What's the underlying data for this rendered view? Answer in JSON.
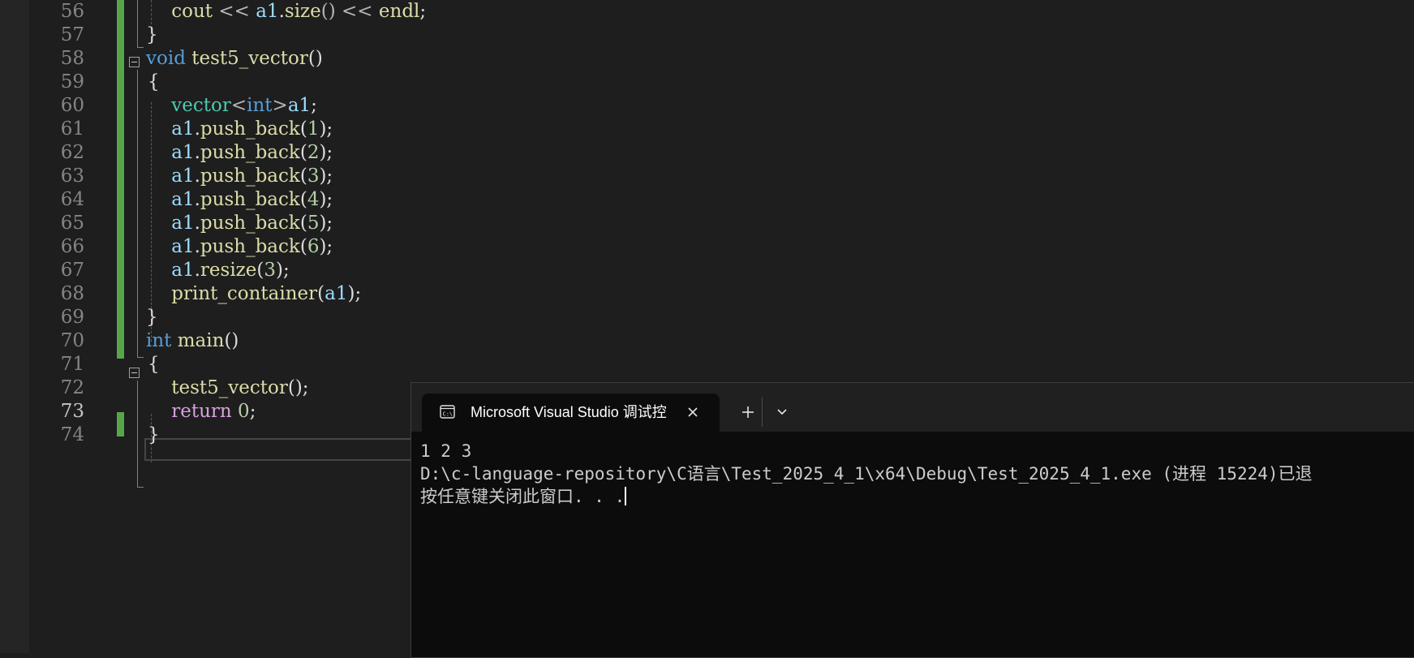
{
  "editor": {
    "line_numbers": [
      "56",
      "57",
      "58",
      "59",
      "60",
      "61",
      "62",
      "63",
      "64",
      "65",
      "66",
      "67",
      "68",
      "69",
      "70",
      "71",
      "72",
      "73",
      "74"
    ],
    "active_line_number": "73",
    "code": {
      "l56": {
        "indent": "    ",
        "t1": "cout",
        "t2": " << ",
        "t3": "a1",
        "t4": ".",
        "t5": "size",
        "t6": "() << ",
        "t7": "endl",
        "t8": ";"
      },
      "l57": "}",
      "l58": {
        "t1": "void",
        "t2": " ",
        "t3": "test5_vector",
        "t4": "()"
      },
      "l59": "{",
      "l60": {
        "indent": "    ",
        "t1": "vector",
        "t2": "<",
        "t3": "int",
        "t4": ">",
        "t5": "a1",
        "t6": ";"
      },
      "l61": {
        "indent": "    ",
        "t1": "a1",
        "t2": ".",
        "t3": "push_back",
        "t4": "(",
        "t5": "1",
        "t6": ");"
      },
      "l62": {
        "indent": "    ",
        "t1": "a1",
        "t2": ".",
        "t3": "push_back",
        "t4": "(",
        "t5": "2",
        "t6": ");"
      },
      "l63": {
        "indent": "    ",
        "t1": "a1",
        "t2": ".",
        "t3": "push_back",
        "t4": "(",
        "t5": "3",
        "t6": ");"
      },
      "l64": {
        "indent": "    ",
        "t1": "a1",
        "t2": ".",
        "t3": "push_back",
        "t4": "(",
        "t5": "4",
        "t6": ");"
      },
      "l65": {
        "indent": "    ",
        "t1": "a1",
        "t2": ".",
        "t3": "push_back",
        "t4": "(",
        "t5": "5",
        "t6": ");"
      },
      "l66": {
        "indent": "    ",
        "t1": "a1",
        "t2": ".",
        "t3": "push_back",
        "t4": "(",
        "t5": "6",
        "t6": ");"
      },
      "l67": {
        "indent": "    ",
        "t1": "a1",
        "t2": ".",
        "t3": "resize",
        "t4": "(",
        "t5": "3",
        "t6": ");"
      },
      "l68": {
        "indent": "    ",
        "t1": "print_container",
        "t2": "(",
        "t3": "a1",
        "t4": ");"
      },
      "l69": "}",
      "l70": {
        "t1": "int",
        "t2": " ",
        "t3": "main",
        "t4": "()"
      },
      "l71": "{",
      "l72": {
        "indent": "    ",
        "t1": "test5_vector",
        "t2": "();"
      },
      "l73": {
        "indent": "    ",
        "t1": "return",
        "t2": " ",
        "t3": "0",
        "t4": ";"
      },
      "l74": "}"
    }
  },
  "terminal": {
    "tab_title": "Microsoft Visual Studio 调试控",
    "lines": [
      "1 2 3",
      "D:\\c-language-repository\\C语言\\Test_2025_4_1\\x64\\Debug\\Test_2025_4_1.exe (进程 15224)已退",
      "按任意键关闭此窗口. . ."
    ]
  },
  "colors": {
    "editor_bg": "#1e1e1e",
    "terminal_bg": "#0c0c0c",
    "change_bar": "#57a64a",
    "keyword": "#569cd6",
    "function": "#dcdcaa",
    "type": "#4ec9b0",
    "variable": "#9cdcfe",
    "number": "#b5cea8",
    "control_keyword": "#d8a0df"
  },
  "icons": {
    "terminal_tab": "console-icon",
    "close": "close-icon",
    "new_tab": "plus-icon",
    "dropdown": "chevron-down-icon",
    "fold": "collapse-icon"
  }
}
